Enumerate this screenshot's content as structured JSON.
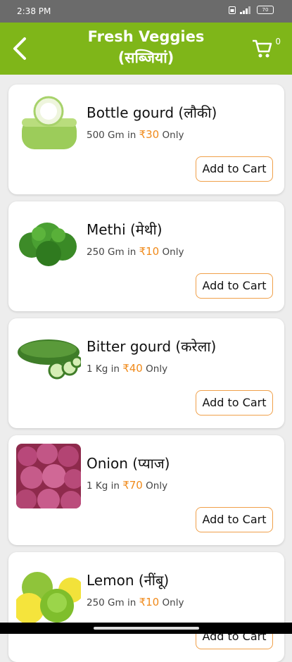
{
  "status": {
    "time": "2:38 PM",
    "battery": "70"
  },
  "appbar": {
    "title_line1": "Fresh Veggies",
    "title_line2": "(सब्जियां)",
    "cart_count": "0"
  },
  "products": [
    {
      "name": "Bottle gourd (लौकी)",
      "quantity": "500 Gm",
      "in": "in",
      "price": "₹30",
      "only": "Only",
      "button": "Add to Cart",
      "image": "bottle-gourd"
    },
    {
      "name": "Methi (मेथी)",
      "quantity": "250 Gm",
      "in": "in",
      "price": "₹10",
      "only": "Only",
      "button": "Add to Cart",
      "image": "methi"
    },
    {
      "name": "Bitter gourd (करेला)",
      "quantity": "1 Kg",
      "in": "in",
      "price": "₹40",
      "only": "Only",
      "button": "Add to Cart",
      "image": "bitter-gourd"
    },
    {
      "name": "Onion (प्याज)",
      "quantity": "1 Kg",
      "in": "in",
      "price": "₹70",
      "only": "Only",
      "button": "Add to Cart",
      "image": "onion"
    },
    {
      "name": "Lemon (नींबू)",
      "quantity": "250 Gm",
      "in": "in",
      "price": "₹10",
      "only": "Only",
      "button": "Add to Cart",
      "image": "lemon"
    }
  ],
  "colors": {
    "appbar": "#7fb619",
    "price": "#f08a1a",
    "button_border": "#f0a04a"
  }
}
